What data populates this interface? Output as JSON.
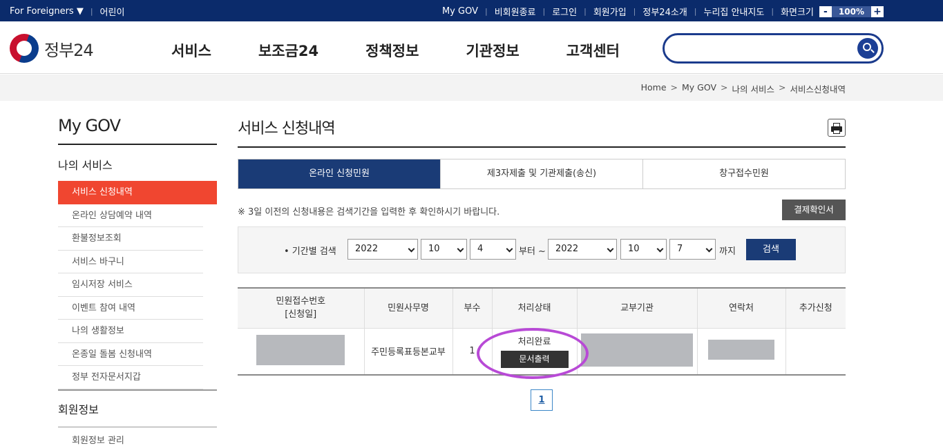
{
  "topbar": {
    "foreigners": "For Foreigners ▼",
    "kids": "어린이",
    "links": [
      "My GOV",
      "비회원종료",
      "로그인",
      "회원가입",
      "정부24소개",
      "누리집 안내지도",
      "화면크기"
    ],
    "zoom_minus": "-",
    "zoom_value": "100%",
    "zoom_plus": "+"
  },
  "header": {
    "logo_text": "정부24",
    "nav": [
      "서비스",
      "보조금24",
      "정책정보",
      "기관정보",
      "고객센터"
    ],
    "search_placeholder": ""
  },
  "breadcrumb": [
    "Home",
    "My GOV",
    "나의 서비스",
    "서비스신청내역"
  ],
  "sidebar": {
    "title": "My GOV",
    "section1": "나의 서비스",
    "items": [
      "서비스 신청내역",
      "온라인 상담예약 내역",
      "환불정보조회",
      "서비스 바구니",
      "임시저장 서비스",
      "이벤트 참여 내역",
      "나의 생활정보",
      "온종일 돌봄 신청내역",
      "정부 전자문서지갑"
    ],
    "section2": "회원정보",
    "cut_item": "회원정보 관리"
  },
  "main": {
    "title": "서비스 신청내역",
    "tabs": [
      "온라인 신청민원",
      "제3자제출 및 기관제출(송신)",
      "창구접수민원"
    ],
    "notice": "※ 3일 이전의 신청내용은 검색기간을 입력한 후 확인하시기 바랍니다.",
    "confirm_button": "결제확인서",
    "filter": {
      "label": "• 기간별 검색",
      "from_year": "2022",
      "from_month": "10",
      "from_day": "4",
      "from_suffix": "부터 ~",
      "to_year": "2022",
      "to_month": "10",
      "to_day": "7",
      "to_suffix": "까지",
      "search_button": "검색"
    },
    "table": {
      "headers": [
        "민원접수번호\n[신청일]",
        "민원사무명",
        "부수",
        "처리상태",
        "교부기관",
        "연락처",
        "추가신청"
      ],
      "header1_line1": "민원접수번호",
      "header1_line2": "[신청일]",
      "row": {
        "service_name": "주민등록표등본교부",
        "copies": "1",
        "status": "처리완료",
        "print_button": "문서출력"
      }
    },
    "page": "1"
  },
  "colors": {
    "topbar": "#0b2b6b",
    "active_tab": "#1a3b76",
    "sidebar_active": "#f04630",
    "highlight_ring": "#b84ad6"
  }
}
